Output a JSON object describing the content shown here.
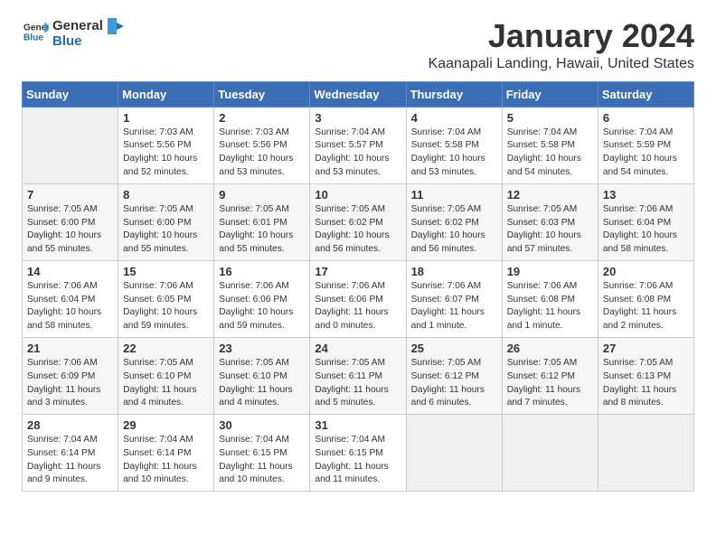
{
  "header": {
    "logo_line1": "General",
    "logo_line2": "Blue",
    "month_title": "January 2024",
    "location": "Kaanapali Landing, Hawaii, United States"
  },
  "weekdays": [
    "Sunday",
    "Monday",
    "Tuesday",
    "Wednesday",
    "Thursday",
    "Friday",
    "Saturday"
  ],
  "weeks": [
    [
      {
        "day": "",
        "info": ""
      },
      {
        "day": "1",
        "info": "Sunrise: 7:03 AM\nSunset: 5:56 PM\nDaylight: 10 hours\nand 52 minutes."
      },
      {
        "day": "2",
        "info": "Sunrise: 7:03 AM\nSunset: 5:56 PM\nDaylight: 10 hours\nand 53 minutes."
      },
      {
        "day": "3",
        "info": "Sunrise: 7:04 AM\nSunset: 5:57 PM\nDaylight: 10 hours\nand 53 minutes."
      },
      {
        "day": "4",
        "info": "Sunrise: 7:04 AM\nSunset: 5:58 PM\nDaylight: 10 hours\nand 53 minutes."
      },
      {
        "day": "5",
        "info": "Sunrise: 7:04 AM\nSunset: 5:58 PM\nDaylight: 10 hours\nand 54 minutes."
      },
      {
        "day": "6",
        "info": "Sunrise: 7:04 AM\nSunset: 5:59 PM\nDaylight: 10 hours\nand 54 minutes."
      }
    ],
    [
      {
        "day": "7",
        "info": "Sunrise: 7:05 AM\nSunset: 6:00 PM\nDaylight: 10 hours\nand 55 minutes."
      },
      {
        "day": "8",
        "info": "Sunrise: 7:05 AM\nSunset: 6:00 PM\nDaylight: 10 hours\nand 55 minutes."
      },
      {
        "day": "9",
        "info": "Sunrise: 7:05 AM\nSunset: 6:01 PM\nDaylight: 10 hours\nand 55 minutes."
      },
      {
        "day": "10",
        "info": "Sunrise: 7:05 AM\nSunset: 6:02 PM\nDaylight: 10 hours\nand 56 minutes."
      },
      {
        "day": "11",
        "info": "Sunrise: 7:05 AM\nSunset: 6:02 PM\nDaylight: 10 hours\nand 56 minutes."
      },
      {
        "day": "12",
        "info": "Sunrise: 7:05 AM\nSunset: 6:03 PM\nDaylight: 10 hours\nand 57 minutes."
      },
      {
        "day": "13",
        "info": "Sunrise: 7:06 AM\nSunset: 6:04 PM\nDaylight: 10 hours\nand 58 minutes."
      }
    ],
    [
      {
        "day": "14",
        "info": "Sunrise: 7:06 AM\nSunset: 6:04 PM\nDaylight: 10 hours\nand 58 minutes."
      },
      {
        "day": "15",
        "info": "Sunrise: 7:06 AM\nSunset: 6:05 PM\nDaylight: 10 hours\nand 59 minutes."
      },
      {
        "day": "16",
        "info": "Sunrise: 7:06 AM\nSunset: 6:06 PM\nDaylight: 10 hours\nand 59 minutes."
      },
      {
        "day": "17",
        "info": "Sunrise: 7:06 AM\nSunset: 6:06 PM\nDaylight: 11 hours\nand 0 minutes."
      },
      {
        "day": "18",
        "info": "Sunrise: 7:06 AM\nSunset: 6:07 PM\nDaylight: 11 hours\nand 1 minute."
      },
      {
        "day": "19",
        "info": "Sunrise: 7:06 AM\nSunset: 6:08 PM\nDaylight: 11 hours\nand 1 minute."
      },
      {
        "day": "20",
        "info": "Sunrise: 7:06 AM\nSunset: 6:08 PM\nDaylight: 11 hours\nand 2 minutes."
      }
    ],
    [
      {
        "day": "21",
        "info": "Sunrise: 7:06 AM\nSunset: 6:09 PM\nDaylight: 11 hours\nand 3 minutes."
      },
      {
        "day": "22",
        "info": "Sunrise: 7:05 AM\nSunset: 6:10 PM\nDaylight: 11 hours\nand 4 minutes."
      },
      {
        "day": "23",
        "info": "Sunrise: 7:05 AM\nSunset: 6:10 PM\nDaylight: 11 hours\nand 4 minutes."
      },
      {
        "day": "24",
        "info": "Sunrise: 7:05 AM\nSunset: 6:11 PM\nDaylight: 11 hours\nand 5 minutes."
      },
      {
        "day": "25",
        "info": "Sunrise: 7:05 AM\nSunset: 6:12 PM\nDaylight: 11 hours\nand 6 minutes."
      },
      {
        "day": "26",
        "info": "Sunrise: 7:05 AM\nSunset: 6:12 PM\nDaylight: 11 hours\nand 7 minutes."
      },
      {
        "day": "27",
        "info": "Sunrise: 7:05 AM\nSunset: 6:13 PM\nDaylight: 11 hours\nand 8 minutes."
      }
    ],
    [
      {
        "day": "28",
        "info": "Sunrise: 7:04 AM\nSunset: 6:14 PM\nDaylight: 11 hours\nand 9 minutes."
      },
      {
        "day": "29",
        "info": "Sunrise: 7:04 AM\nSunset: 6:14 PM\nDaylight: 11 hours\nand 10 minutes."
      },
      {
        "day": "30",
        "info": "Sunrise: 7:04 AM\nSunset: 6:15 PM\nDaylight: 11 hours\nand 10 minutes."
      },
      {
        "day": "31",
        "info": "Sunrise: 7:04 AM\nSunset: 6:15 PM\nDaylight: 11 hours\nand 11 minutes."
      },
      {
        "day": "",
        "info": ""
      },
      {
        "day": "",
        "info": ""
      },
      {
        "day": "",
        "info": ""
      }
    ]
  ]
}
